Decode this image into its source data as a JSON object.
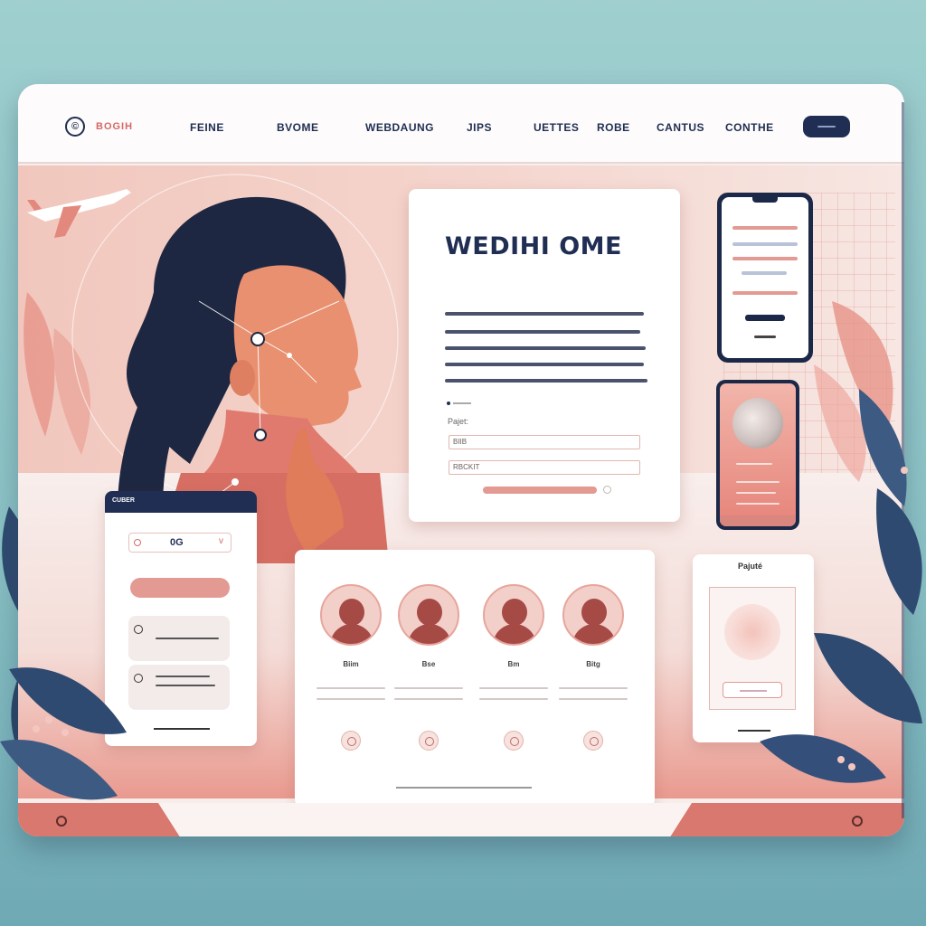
{
  "nav": {
    "logo_text": "BOGIH",
    "items": [
      "FEINE",
      "BVOME",
      "WEBDAUNG",
      "JIPS",
      "UETTES",
      "ROBE",
      "CANTUS",
      "CONTHE"
    ]
  },
  "welcome": {
    "title": "WEDIHI OME",
    "field1_label": "Pajet:",
    "field1_value": "BIIB",
    "field2_value": "RBCKIT"
  },
  "select_card": {
    "header": "CUBER",
    "dropdown_value": "0G"
  },
  "team": {
    "members": [
      {
        "name": "Biim"
      },
      {
        "name": "Bse"
      },
      {
        "name": "Bm"
      },
      {
        "name": "Bitg"
      }
    ]
  },
  "profile": {
    "title": "Pajuté"
  },
  "colors": {
    "navy": "#1f2e52",
    "coral": "#e39a92",
    "blush": "#f4d3cb",
    "teal_bg": "#8cc3c6"
  }
}
